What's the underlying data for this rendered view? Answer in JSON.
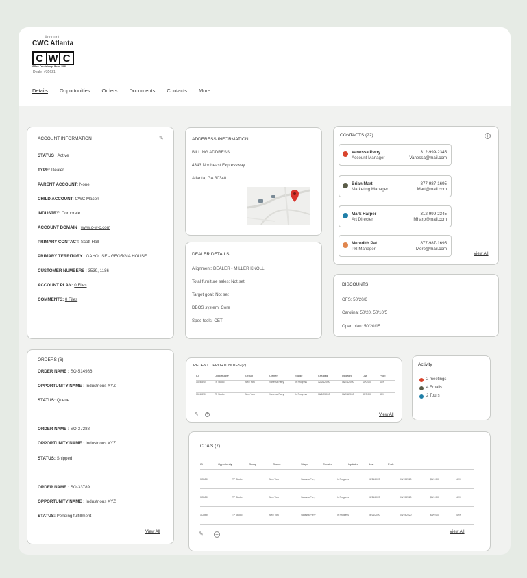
{
  "header": {
    "account_label": "Account",
    "account_name": "CWC Atlanta",
    "logo_letters": [
      "C",
      "W",
      "C"
    ],
    "logo_tagline": "Office Furnishings Since 1959",
    "dealer_id": "Dealer #35621"
  },
  "tabs": [
    "Details",
    "Opportunities",
    "Orders",
    "Documents",
    "Contacts",
    "More"
  ],
  "account_info": {
    "title": "ACCOUNT INFORMATION",
    "rows": [
      {
        "label": "STATUS",
        "sep": " : ",
        "value": "Active"
      },
      {
        "label": "TYPE:",
        "sep": " ",
        "value": "Dealer"
      },
      {
        "label": "PARENT ACCOUNT",
        "sep": ": ",
        "value": "None"
      },
      {
        "label": "CHILD ACCOUNT:",
        "sep": " ",
        "value": "CWC Macon"
      },
      {
        "label": "INDUSTRY:",
        "sep": " ",
        "value": "Corporate"
      },
      {
        "label": "ACCOUNT DOMAIN",
        "sep": " : ",
        "value": "www.c-w-c.com"
      },
      {
        "label": "PRIMARY CONTACT:",
        "sep": " ",
        "value": "Scott Hall"
      },
      {
        "label": "PRIMARY TERRITORY",
        "sep": " : ",
        "value": "GAHOUSE - GEORGIA HOUSE"
      },
      {
        "label": "CUSTOMER NUMBERS",
        "sep": " : ",
        "value": "3539, 1186"
      },
      {
        "label": "ACCOUNT PLAN:",
        "sep": " ",
        "value": "0 Files"
      },
      {
        "label": "COMMENTS:",
        "sep": " ",
        "value": "0 Files"
      }
    ]
  },
  "address": {
    "title": "ADDERESS INFORMATION",
    "billing_label": "BILLING ADDRESS",
    "street": "4343 Northeast Expressway",
    "city": "Atlanta, GA 30340"
  },
  "dealer": {
    "title": "DEALER DETAILS",
    "alignment": "Alignment: DEALER - MILLER KNOLL",
    "sales_label": "Total furniture sales:",
    "sales_value": "Not set",
    "goal_label": "Target goal:",
    "goal_value": "Not set",
    "dbos": "DBOS system: Core",
    "spec_label": "Spec tools:",
    "spec_value": "CET"
  },
  "contacts": {
    "title": "CONTACTS (22)",
    "view_all": "View All",
    "items": [
      {
        "name": "Vanessa Perry",
        "role": "Account Manager",
        "phone": "312-999-2345",
        "email": "Vanessa@mail.com",
        "color": "#d9442c"
      },
      {
        "name": "Brian Mart",
        "role": "Marketing Manager",
        "phone": "877-987-1695",
        "email": "Mart@mail.com",
        "color": "#5a5c48"
      },
      {
        "name": "Mark Harper",
        "role": "Art Directer",
        "phone": "312-999-2345",
        "email": "Mharp@mail.com",
        "color": "#1f7fa8"
      },
      {
        "name": "Meredith Pat",
        "role": "PR Manager",
        "phone": "877-987-1695",
        "email": "Mere@mail.com",
        "color": "#e0864e"
      }
    ]
  },
  "discounts": {
    "title": "DISCOUNTS",
    "ofs": "OFS: 50/20/6",
    "carolina": "Carolina: 50/20, 50/10/5",
    "open_plan": "Open plan: 50/20/15"
  },
  "orders": {
    "title": "ORDERS (6)",
    "view_all": "View All",
    "items": [
      {
        "order_label": "ORDER NAME :",
        "order": "SO-514986",
        "opp_label": "OPPORTUNITY NAME :",
        "opp": "Industrious XYZ",
        "status_label": "STATUS:",
        "status": "Queue"
      },
      {
        "order_label": "ORDER NAME :",
        "order": "SO-37288",
        "opp_label": "OPPORTUNITY NAME :",
        "opp": "Industrious XYZ",
        "status_label": "STATUS:",
        "status": "Shipped"
      },
      {
        "order_label": "ORDER NAME :",
        "order": "SO-33789",
        "opp_label": "OPPORTUNITY NAME :",
        "opp": "Industrious XYZ",
        "status_label": "STATUS:",
        "status": "Pending fulfillment"
      }
    ]
  },
  "opportunities": {
    "title": "RECENT OPPORTUNITIES (7)",
    "view_all": "View All",
    "columns": [
      "ID",
      "Opportunity",
      "Group",
      "Owner",
      "Stage",
      "Created",
      "Updated",
      "List",
      "Prob"
    ],
    "rows": [
      [
        "1024 890",
        "TP Studio",
        "New York",
        "Vanessa Perry",
        "In Progress",
        "12/2/12 000",
        "06/7/12 000",
        "$0/0 000",
        "40%"
      ],
      [
        "1024 890",
        "TP Studio",
        "New York",
        "Vanessa Perry",
        "In Progress",
        "06/2/23 000",
        "06/7/12 000",
        "$0/0 000",
        "40%"
      ]
    ]
  },
  "activity": {
    "title": "Activity",
    "items": [
      {
        "text": "2 meetings",
        "color": "#d9442c"
      },
      {
        "text": "4 Emails",
        "color": "#5a5c48"
      },
      {
        "text": "2 Tours",
        "color": "#1f7fa8"
      }
    ]
  },
  "cdas": {
    "title": "CDA'S (7)",
    "view_all": "View All",
    "columns": [
      "ID",
      "Opportunity",
      "Group",
      "Owner",
      "Stage",
      "Created",
      "Updated",
      "List",
      "Prob"
    ],
    "rows": [
      [
        "1CD890",
        "TP Studio",
        "New York",
        "Vanessa Perry",
        "In Progress",
        "06/21/2020",
        "06/19/2020",
        "$0/0 000",
        "40%"
      ],
      [
        "1CD890",
        "TP Studio",
        "New York",
        "Vanessa Perry",
        "In Progress",
        "06/21/2020",
        "06/19/2020",
        "$0/0 000",
        "40%"
      ],
      [
        "1CD890",
        "TP Studio",
        "New York",
        "Vanessa Perry",
        "In Progress",
        "06/21/2020",
        "06/19/2020",
        "$0/0 000",
        "40%"
      ]
    ]
  }
}
